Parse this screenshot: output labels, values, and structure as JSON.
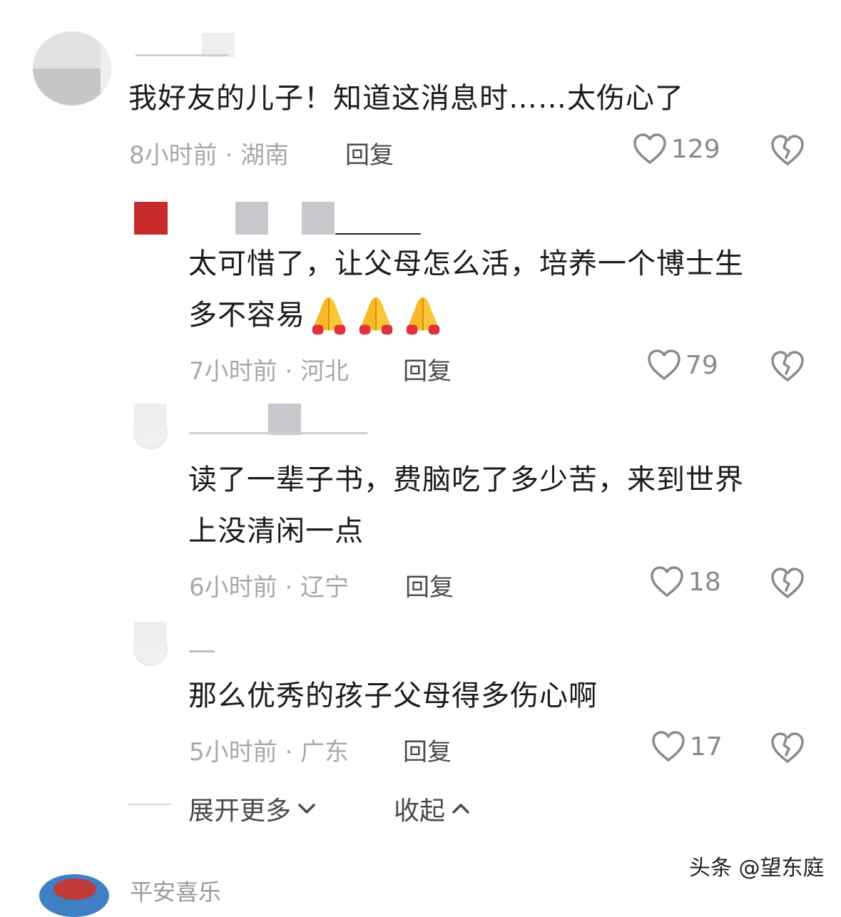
{
  "comments": [
    {
      "text": "我好友的儿子！知道这消息时……太伤心了",
      "meta": "8小时前 · 湖南",
      "reply": "回复",
      "likes": "129"
    },
    {
      "text_line1": "太可惜了，让父母怎么活，培养一个博士生",
      "text_line2": "多不容易",
      "emoji": "folded-hands",
      "meta": "7小时前 · 河北",
      "reply": "回复",
      "likes": "79"
    },
    {
      "text_line1": "读了一辈子书，费脑吃了多少苦，来到世界",
      "text_line2": "上没清闲一点",
      "meta": "6小时前 · 辽宁",
      "reply": "回复",
      "likes": "18"
    },
    {
      "text": "那么优秀的孩子父母得多伤心啊",
      "meta": "5小时前 · 广东",
      "reply": "回复",
      "likes": "17"
    }
  ],
  "expand": {
    "more_label": "展开更多",
    "collapse_label": "收起"
  },
  "watermark": "头条 @望东庭",
  "next_comment": {
    "name": "平安喜乐"
  },
  "colors": {
    "text": "#1b1b1b",
    "meta": "#a8a8a8",
    "red_avatar": "#c62a2a"
  }
}
